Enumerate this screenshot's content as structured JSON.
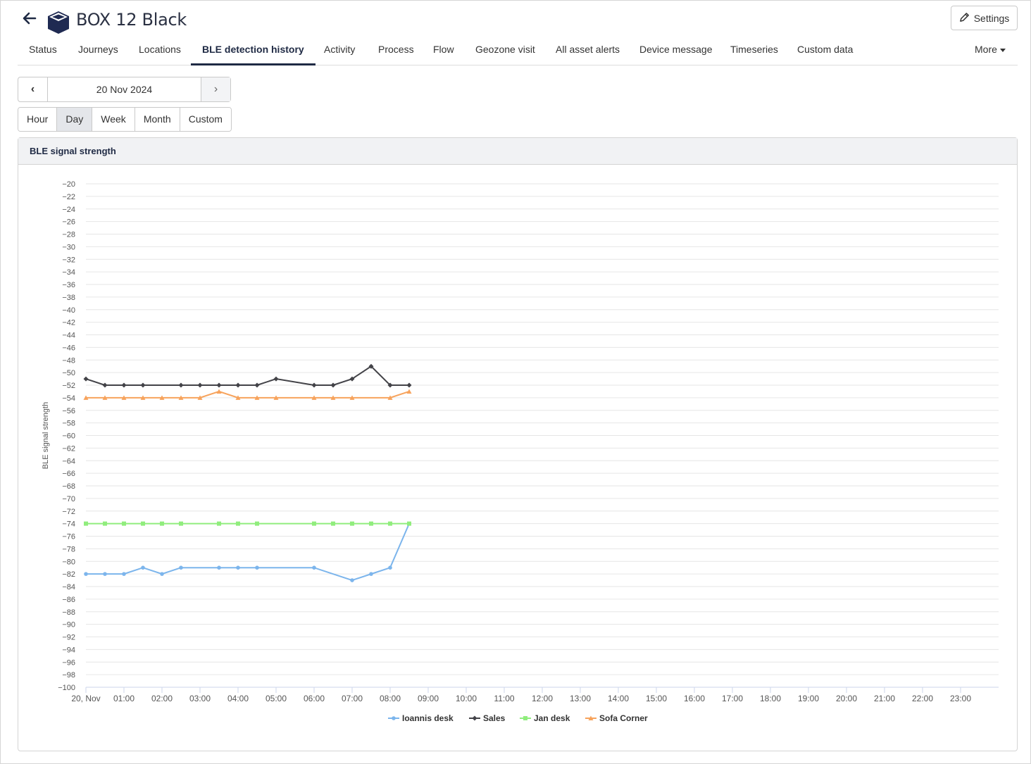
{
  "header": {
    "title": "BOX 12 Black",
    "settings_label": "Settings"
  },
  "tabs": [
    {
      "label": "Status"
    },
    {
      "label": "Journeys"
    },
    {
      "label": "Locations"
    },
    {
      "label": "BLE detection history",
      "active": true
    },
    {
      "label": "Activity"
    },
    {
      "label": "Process"
    },
    {
      "label": "Flow"
    },
    {
      "label": "Geozone visit"
    },
    {
      "label": "All asset alerts"
    },
    {
      "label": "Device message"
    },
    {
      "label": "Timeseries"
    },
    {
      "label": "Custom data"
    }
  ],
  "more_label": "More",
  "date_nav": {
    "date": "20 Nov 2024",
    "prev_symbol": "‹",
    "next_symbol": "›"
  },
  "ranges": [
    {
      "label": "Hour"
    },
    {
      "label": "Day",
      "active": true
    },
    {
      "label": "Week"
    },
    {
      "label": "Month"
    },
    {
      "label": "Custom"
    }
  ],
  "panel": {
    "title": "BLE signal strength"
  },
  "chart_data": {
    "type": "line",
    "ylabel": "BLE signal strength",
    "ylim": [
      -100,
      -20
    ],
    "ytick_step": 2,
    "xlim_hours": [
      0,
      24
    ],
    "x_tick_labels": [
      "20, Nov",
      "01:00",
      "02:00",
      "03:00",
      "04:00",
      "05:00",
      "06:00",
      "07:00",
      "08:00",
      "09:00",
      "10:00",
      "11:00",
      "12:00",
      "13:00",
      "14:00",
      "15:00",
      "16:00",
      "17:00",
      "18:00",
      "19:00",
      "20:00",
      "21:00",
      "22:00",
      "23:00"
    ],
    "grid": true,
    "legend_position": "bottom",
    "series": [
      {
        "name": "Ioannis desk",
        "color": "#7cb5ec",
        "marker": "circle",
        "points": [
          [
            0,
            -82
          ],
          [
            0.5,
            -82
          ],
          [
            1,
            -82
          ],
          [
            1.5,
            -81
          ],
          [
            2,
            -82
          ],
          [
            2.5,
            -81
          ],
          [
            3.5,
            -81
          ],
          [
            4,
            -81
          ],
          [
            4.5,
            -81
          ],
          [
            6,
            -81
          ],
          [
            7,
            -83
          ],
          [
            7.5,
            -82
          ],
          [
            8,
            -81
          ],
          [
            8.5,
            -74
          ]
        ]
      },
      {
        "name": "Sales",
        "color": "#434348",
        "marker": "diamond",
        "points": [
          [
            0,
            -51
          ],
          [
            0.5,
            -52
          ],
          [
            1,
            -52
          ],
          [
            1.5,
            -52
          ],
          [
            2.5,
            -52
          ],
          [
            3,
            -52
          ],
          [
            3.5,
            -52
          ],
          [
            4,
            -52
          ],
          [
            4.5,
            -52
          ],
          [
            5,
            -51
          ],
          [
            6,
            -52
          ],
          [
            6.5,
            -52
          ],
          [
            7,
            -51
          ],
          [
            7.5,
            -49
          ],
          [
            8,
            -52
          ],
          [
            8.5,
            -52
          ]
        ]
      },
      {
        "name": "Jan desk",
        "color": "#90ed7d",
        "marker": "square",
        "points": [
          [
            0,
            -74
          ],
          [
            0.5,
            -74
          ],
          [
            1,
            -74
          ],
          [
            1.5,
            -74
          ],
          [
            2,
            -74
          ],
          [
            2.5,
            -74
          ],
          [
            3.5,
            -74
          ],
          [
            4,
            -74
          ],
          [
            4.5,
            -74
          ],
          [
            6,
            -74
          ],
          [
            6.5,
            -74
          ],
          [
            7,
            -74
          ],
          [
            7.5,
            -74
          ],
          [
            8,
            -74
          ],
          [
            8.5,
            -74
          ]
        ]
      },
      {
        "name": "Sofa Corner",
        "color": "#f7a35c",
        "marker": "triangle",
        "points": [
          [
            0,
            -54
          ],
          [
            0.5,
            -54
          ],
          [
            1,
            -54
          ],
          [
            1.5,
            -54
          ],
          [
            2,
            -54
          ],
          [
            2.5,
            -54
          ],
          [
            3,
            -54
          ],
          [
            3.5,
            -53
          ],
          [
            4,
            -54
          ],
          [
            4.5,
            -54
          ],
          [
            5,
            -54
          ],
          [
            6,
            -54
          ],
          [
            6.5,
            -54
          ],
          [
            7,
            -54
          ],
          [
            8,
            -54
          ],
          [
            8.5,
            -53
          ]
        ]
      }
    ]
  }
}
